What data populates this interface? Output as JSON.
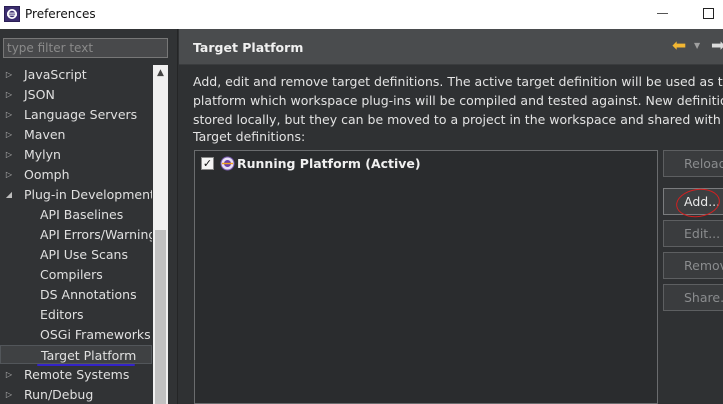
{
  "window": {
    "title": "Preferences",
    "icon": "eclipse-icon"
  },
  "filter": {
    "placeholder": "type filter text",
    "value": ""
  },
  "tree": {
    "items": [
      {
        "label": "JavaScript",
        "indent": 0,
        "arrow": "collapsed"
      },
      {
        "label": "JSON",
        "indent": 0,
        "arrow": "collapsed"
      },
      {
        "label": "Language Servers",
        "indent": 0,
        "arrow": "collapsed"
      },
      {
        "label": "Maven",
        "indent": 0,
        "arrow": "collapsed"
      },
      {
        "label": "Mylyn",
        "indent": 0,
        "arrow": "collapsed"
      },
      {
        "label": "Oomph",
        "indent": 0,
        "arrow": "collapsed"
      },
      {
        "label": "Plug-in Development",
        "indent": 0,
        "arrow": "expanded"
      },
      {
        "label": "API Baselines",
        "indent": 1,
        "arrow": "none"
      },
      {
        "label": "API Errors/Warnings",
        "indent": 1,
        "arrow": "none"
      },
      {
        "label": "API Use Scans",
        "indent": 1,
        "arrow": "none"
      },
      {
        "label": "Compilers",
        "indent": 1,
        "arrow": "none"
      },
      {
        "label": "DS Annotations",
        "indent": 1,
        "arrow": "none"
      },
      {
        "label": "Editors",
        "indent": 1,
        "arrow": "none"
      },
      {
        "label": "OSGi Frameworks",
        "indent": 1,
        "arrow": "none"
      },
      {
        "label": "Target Platform",
        "indent": 1,
        "arrow": "none",
        "selected": true
      },
      {
        "label": "Remote Systems",
        "indent": 0,
        "arrow": "collapsed"
      },
      {
        "label": "Run/Debug",
        "indent": 0,
        "arrow": "collapsed"
      }
    ]
  },
  "page": {
    "title": "Target Platform",
    "description_lines": [
      "Add, edit and remove target definitions.  The active target definition will be used as the targ",
      "platform which workspace plug-ins will be compiled and tested against.  New definitions ar",
      "stored locally, but they can be moved to a project in the workspace and shared with others"
    ],
    "definitions_label": "Target definitions:",
    "definitions": [
      {
        "label": "Running Platform (Active)",
        "checked": true
      }
    ]
  },
  "buttons": [
    {
      "label": "Reload",
      "enabled": false
    },
    {
      "label": "Add...",
      "enabled": true
    },
    {
      "label": "Edit...",
      "enabled": false
    },
    {
      "label": "Remove",
      "enabled": false
    },
    {
      "label": "Share...",
      "enabled": false
    }
  ],
  "colors": {
    "annotation": "#d22020",
    "selection_underline": "#3323c8",
    "back_arrow": "#f2b632"
  }
}
